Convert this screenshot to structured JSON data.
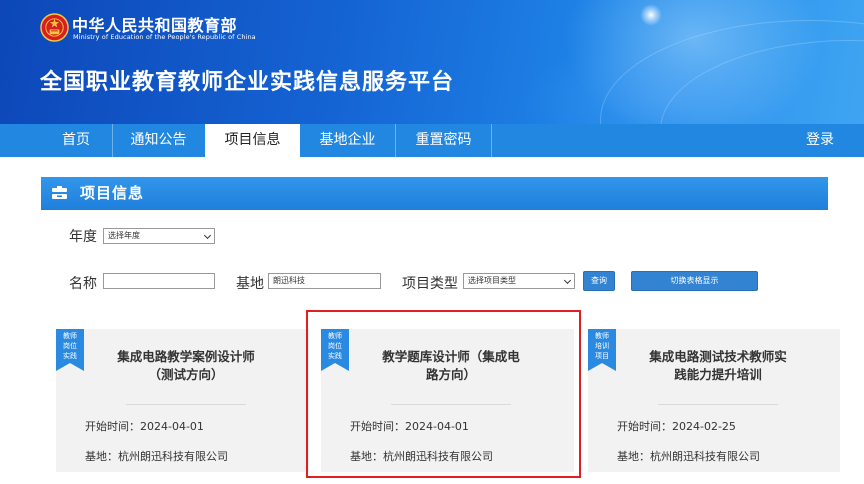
{
  "header": {
    "ministry_cn": "中华人民共和国教育部",
    "ministry_en": "Ministry of Education of the People's Republic of China",
    "platform_title": "全国职业教育教师企业实践信息服务平台"
  },
  "nav": {
    "items": [
      {
        "label": "首页"
      },
      {
        "label": "通知公告"
      },
      {
        "label": "项目信息",
        "active": true
      },
      {
        "label": "基地企业"
      },
      {
        "label": "重置密码"
      }
    ],
    "login": "登录"
  },
  "section": {
    "title": "项目信息"
  },
  "filters": {
    "year_label": "年度",
    "year_value": "选择年度",
    "name_label": "名称",
    "name_value": "",
    "base_label": "基地",
    "base_value": "朗迅科技",
    "type_label": "项目类型",
    "type_value": "选择项目类型",
    "query_button": "查询",
    "table_toggle": "切换表格显示"
  },
  "cards": [
    {
      "ribbon": [
        "教师",
        "岗位",
        "实践"
      ],
      "title_lines": [
        "集成电路教学案例设计师",
        "（测试方向）"
      ],
      "start_time": "开始时间：2024-04-01",
      "base": "基地：杭州朗迅科技有限公司"
    },
    {
      "ribbon": [
        "教师",
        "岗位",
        "实践"
      ],
      "title_lines": [
        "教学题库设计师（集成电",
        "路方向）"
      ],
      "start_time": "开始时间：2024-04-01",
      "base": "基地：杭州朗迅科技有限公司",
      "highlighted": true
    },
    {
      "ribbon": [
        "教师",
        "培训",
        "项目"
      ],
      "title_lines": [
        "集成电路测试技术教师实",
        "践能力提升培训"
      ],
      "start_time": "开始时间：2024-02-25",
      "base": "基地：杭州朗迅科技有限公司"
    }
  ],
  "colors": {
    "nav_bg": "#2187e0",
    "section_bg": "#1f7fdc",
    "button_bg": "#3283d2",
    "ribbon_bg": "#2a8ae2",
    "highlight_border": "#e02020"
  }
}
